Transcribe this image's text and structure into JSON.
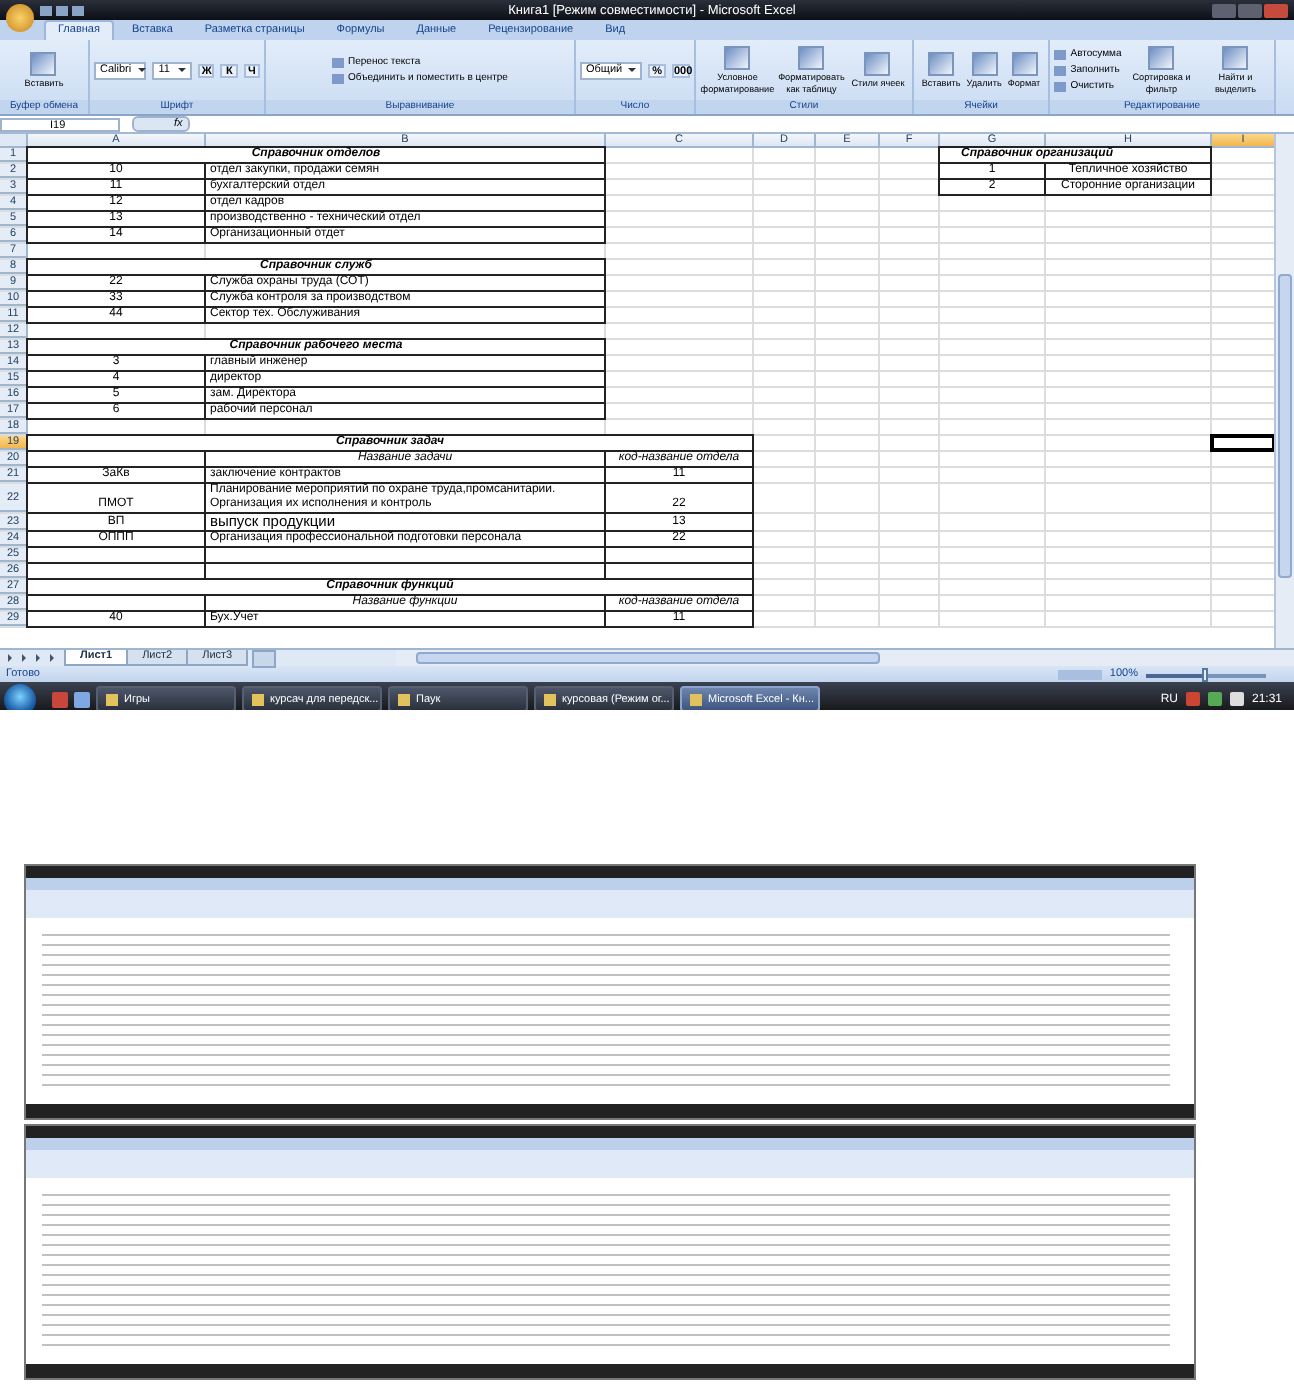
{
  "window": {
    "title": "Книга1  [Режим совместимости] - Microsoft Excel"
  },
  "ribbon_tabs": [
    {
      "label": "Главная",
      "selected": true
    },
    {
      "label": "Вставка",
      "selected": false
    },
    {
      "label": "Разметка страницы",
      "selected": false
    },
    {
      "label": "Формулы",
      "selected": false
    },
    {
      "label": "Данные",
      "selected": false
    },
    {
      "label": "Рецензирование",
      "selected": false
    },
    {
      "label": "Вид",
      "selected": false
    }
  ],
  "ribbon_groups": [
    {
      "label": "Буфер обмена",
      "controls": [
        {
          "kind": "large",
          "text": "Вставить"
        }
      ]
    },
    {
      "label": "Шрифт",
      "controls": [
        {
          "kind": "dropdown",
          "text": "Calibri"
        },
        {
          "kind": "dropdown",
          "text": "11"
        },
        {
          "kind": "glyph",
          "text": "Ж"
        },
        {
          "kind": "glyph",
          "text": "К"
        },
        {
          "kind": "glyph",
          "text": "Ч"
        }
      ]
    },
    {
      "label": "Выравнивание",
      "controls": [
        {
          "kind": "small",
          "text": "Перенос текста"
        },
        {
          "kind": "small",
          "text": "Объединить и поместить в центре"
        }
      ]
    },
    {
      "label": "Число",
      "controls": [
        {
          "kind": "dropdown",
          "text": "Общий"
        },
        {
          "kind": "glyph",
          "text": "%"
        },
        {
          "kind": "glyph",
          "text": "000"
        }
      ]
    },
    {
      "label": "Стили",
      "controls": [
        {
          "kind": "large",
          "text": "Условное форматирование"
        },
        {
          "kind": "large",
          "text": "Форматировать как таблицу"
        },
        {
          "kind": "large",
          "text": "Стили ячеек"
        }
      ]
    },
    {
      "label": "Ячейки",
      "controls": [
        {
          "kind": "large",
          "text": "Вставить"
        },
        {
          "kind": "large",
          "text": "Удалить"
        },
        {
          "kind": "large",
          "text": "Формат"
        }
      ]
    },
    {
      "label": "Редактирование",
      "controls": [
        {
          "kind": "small",
          "text": "Автосумма"
        },
        {
          "kind": "small",
          "text": "Заполнить"
        },
        {
          "kind": "small",
          "text": "Очистить"
        },
        {
          "kind": "large",
          "text": "Сортировка и фильтр"
        },
        {
          "kind": "large",
          "text": "Найти и выделить"
        }
      ]
    }
  ],
  "formula_bar": {
    "name_box": "I19",
    "fx": "fx"
  },
  "sheet": {
    "columns": [
      {
        "label": "A",
        "selected": false
      },
      {
        "label": "B",
        "selected": false
      },
      {
        "label": "C",
        "selected": false
      },
      {
        "label": "D",
        "selected": false
      },
      {
        "label": "E",
        "selected": false
      },
      {
        "label": "F",
        "selected": false
      },
      {
        "label": "G",
        "selected": false
      },
      {
        "label": "H",
        "selected": false
      },
      {
        "label": "I",
        "selected": true
      }
    ],
    "rows": [
      {
        "number": "1",
        "selected": false,
        "cells": [
          {
            "kind": "title",
            "text": "Справочник отделов"
          },
          {
            "kind": "merged"
          },
          {
            "kind": "none"
          },
          {
            "kind": "none"
          },
          {
            "kind": "none"
          },
          {
            "kind": "none"
          },
          {
            "kind": "title",
            "text": "Справочник организаций"
          },
          {
            "kind": "merged"
          }
        ]
      },
      {
        "number": "2",
        "selected": false,
        "cells": [
          {
            "kind": "center",
            "text": "10"
          },
          {
            "kind": "left",
            "text": "отдел закупки, продажи семян"
          },
          {
            "kind": "none"
          },
          {
            "kind": "none"
          },
          {
            "kind": "none"
          },
          {
            "kind": "none"
          },
          {
            "kind": "center",
            "text": "1"
          },
          {
            "kind": "center",
            "text": "Тепличное хозяйство"
          }
        ]
      },
      {
        "number": "3",
        "selected": false,
        "cells": [
          {
            "kind": "center",
            "text": "11"
          },
          {
            "kind": "left",
            "text": "бухгалтерский отдел"
          },
          {
            "kind": "none"
          },
          {
            "kind": "none"
          },
          {
            "kind": "none"
          },
          {
            "kind": "none"
          },
          {
            "kind": "center",
            "text": "2"
          },
          {
            "kind": "center",
            "text": "Сторонние организации"
          }
        ]
      },
      {
        "number": "4",
        "selected": false,
        "cells": [
          {
            "kind": "center",
            "text": "12"
          },
          {
            "kind": "left",
            "text": "отдел кадров"
          }
        ]
      },
      {
        "number": "5",
        "selected": false,
        "cells": [
          {
            "kind": "center",
            "text": "13"
          },
          {
            "kind": "left",
            "text": "производственно - технический отдел"
          }
        ]
      },
      {
        "number": "6",
        "selected": false,
        "cells": [
          {
            "kind": "center",
            "text": "14"
          },
          {
            "kind": "left",
            "text": "Организационный отдет"
          }
        ]
      },
      {
        "number": "7",
        "selected": false,
        "cells": []
      },
      {
        "number": "8",
        "selected": false,
        "cells": [
          {
            "kind": "title",
            "text": "Справочник служб"
          },
          {
            "kind": "merged"
          }
        ]
      },
      {
        "number": "9",
        "selected": false,
        "cells": [
          {
            "kind": "center",
            "text": "22"
          },
          {
            "kind": "left",
            "text": "Служба охраны труда (СОТ)"
          }
        ]
      },
      {
        "number": "10",
        "selected": false,
        "cells": [
          {
            "kind": "center",
            "text": "33"
          },
          {
            "kind": "left",
            "text": "Служба контроля за производством"
          }
        ]
      },
      {
        "number": "11",
        "selected": false,
        "cells": [
          {
            "kind": "center",
            "text": "44"
          },
          {
            "kind": "left",
            "text": "Сектор тех. Обслуживания"
          }
        ]
      },
      {
        "number": "12",
        "selected": false,
        "cells": []
      },
      {
        "number": "13",
        "selected": false,
        "cells": [
          {
            "kind": "title",
            "text": "Справочник рабочего места"
          },
          {
            "kind": "merged"
          }
        ]
      },
      {
        "number": "14",
        "selected": false,
        "cells": [
          {
            "kind": "center",
            "text": "3"
          },
          {
            "kind": "left",
            "text": "главный инженер"
          }
        ]
      },
      {
        "number": "15",
        "selected": false,
        "cells": [
          {
            "kind": "center",
            "text": "4"
          },
          {
            "kind": "left",
            "text": "директор"
          }
        ]
      },
      {
        "number": "16",
        "selected": false,
        "cells": [
          {
            "kind": "center",
            "text": "5"
          },
          {
            "kind": "left",
            "text": "зам. Директора"
          }
        ]
      },
      {
        "number": "17",
        "selected": false,
        "cells": [
          {
            "kind": "center",
            "text": "6"
          },
          {
            "kind": "left",
            "text": "рабочий персонал"
          }
        ]
      },
      {
        "number": "18",
        "selected": false,
        "cells": []
      },
      {
        "number": "19",
        "selected": true,
        "cells": [
          {
            "kind": "title",
            "text": "Справочник задач"
          },
          {
            "kind": "merged"
          },
          {
            "kind": "merged"
          },
          {
            "kind": "none"
          },
          {
            "kind": "none"
          },
          {
            "kind": "none"
          },
          {
            "kind": "none"
          },
          {
            "kind": "none"
          },
          {
            "kind": "blank",
            "selected": true
          }
        ]
      },
      {
        "number": "20",
        "selected": false,
        "cells": [
          {
            "kind": "blank"
          },
          {
            "kind": "header",
            "text": "Название задачи"
          },
          {
            "kind": "header",
            "text": "код-название отдела"
          }
        ]
      },
      {
        "number": "21",
        "selected": false,
        "cells": [
          {
            "kind": "center",
            "text": "ЗаКв"
          },
          {
            "kind": "left",
            "text": "заключение контрактов"
          },
          {
            "kind": "center",
            "text": "11"
          }
        ]
      },
      {
        "number": "22",
        "selected": false,
        "cells": [
          {
            "kind": "center",
            "text": "ПМОТ"
          },
          {
            "kind": "left",
            "lines": [
              "Планирование мероприятий по охране труда,промсанитарии.",
              "Организация их исполнения и контроль"
            ]
          },
          {
            "kind": "center",
            "text": "22"
          }
        ]
      },
      {
        "number": "23",
        "selected": false,
        "cells": [
          {
            "kind": "center",
            "text": "ВП"
          },
          {
            "kind": "large",
            "text": "выпуск  продукции"
          },
          {
            "kind": "center",
            "text": "13"
          }
        ]
      },
      {
        "number": "24",
        "selected": false,
        "cells": [
          {
            "kind": "center",
            "text": "ОППП"
          },
          {
            "kind": "left",
            "text": "Организация профессиональной подготовки персонала"
          },
          {
            "kind": "center",
            "text": "22"
          }
        ]
      },
      {
        "number": "25",
        "selected": false,
        "cells": [
          {
            "kind": "blank"
          },
          {
            "kind": "blank"
          },
          {
            "kind": "blank"
          }
        ]
      },
      {
        "number": "26",
        "selected": false,
        "cells": [
          {
            "kind": "blank"
          },
          {
            "kind": "blank"
          },
          {
            "kind": "blank"
          }
        ]
      },
      {
        "number": "27",
        "selected": false,
        "cells": [
          {
            "kind": "title",
            "text": "Справочник функций"
          },
          {
            "kind": "merged"
          },
          {
            "kind": "merged"
          }
        ]
      },
      {
        "number": "28",
        "selected": false,
        "cells": [
          {
            "kind": "blank"
          },
          {
            "kind": "header",
            "text": "Название функции"
          },
          {
            "kind": "header",
            "text": "код-название отдела"
          }
        ]
      },
      {
        "number": "29",
        "selected": false,
        "cells": [
          {
            "kind": "center",
            "text": "40"
          },
          {
            "kind": "left",
            "text": "Бух.Учет"
          },
          {
            "kind": "center",
            "text": "11"
          }
        ]
      }
    ]
  },
  "sheet_tabs": [
    {
      "label": "Лист1",
      "selected": true
    },
    {
      "label": "Лист2",
      "selected": false
    },
    {
      "label": "Лист3",
      "selected": false
    }
  ],
  "status_bar": {
    "text": "Готово",
    "zoom": "100%",
    "level": 0.5
  },
  "taskbar": {
    "items": [
      {
        "text": "Игры",
        "selected": false
      },
      {
        "text": "курсач для передск...",
        "selected": false
      },
      {
        "text": "Паук",
        "selected": false
      },
      {
        "text": "курсовая (Режим ог...",
        "selected": false
      },
      {
        "text": "Microsoft Excel - Кн...",
        "selected": true
      }
    ],
    "language": "RU",
    "clock": "21:31"
  }
}
